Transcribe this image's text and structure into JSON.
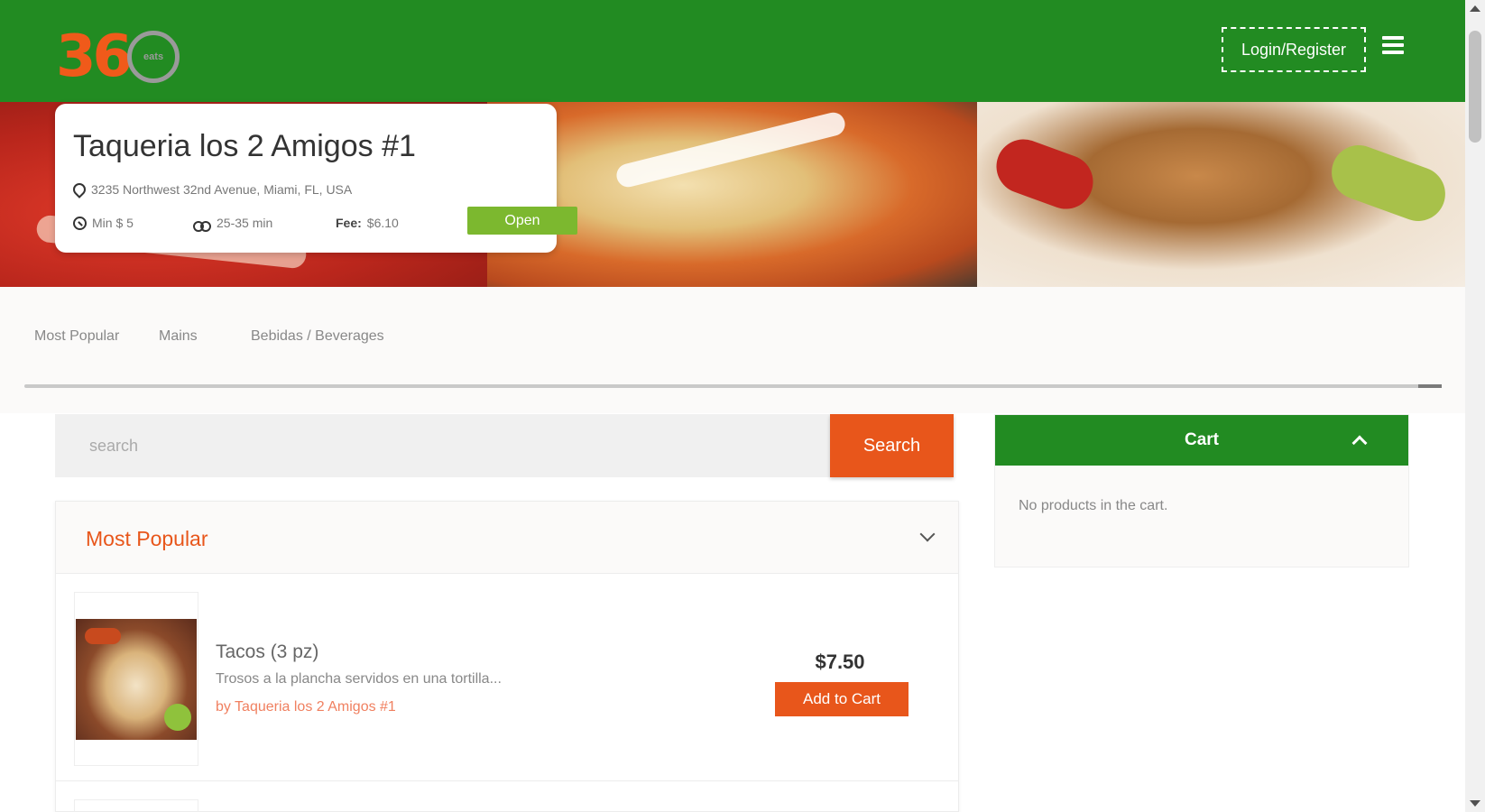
{
  "header": {
    "logo_text": "36",
    "logo_sub": "eats",
    "login_label": "Login/Register"
  },
  "restaurant": {
    "name": "Taqueria los 2 Amigos #1",
    "address": "3235 Northwest 32nd Avenue, Miami, FL, USA",
    "min_order": "Min $ 5",
    "delivery_time": "25-35 min",
    "fee_label": "Fee:",
    "fee_value": "$6.10",
    "status": "Open"
  },
  "categories": [
    "Most Popular",
    "Mains",
    "Bebidas / Beverages"
  ],
  "search": {
    "placeholder": "search",
    "button_label": "Search"
  },
  "menu_section": {
    "title": "Most Popular",
    "products": [
      {
        "name": "Tacos (3 pz)",
        "description": "Trosos a la plancha servidos en una tortilla...",
        "by": "by Taqueria los 2 Amigos #1",
        "price": "$7.50",
        "button_label": "Add to Cart"
      }
    ]
  },
  "cart": {
    "title": "Cart",
    "empty_text": "No products in the cart."
  },
  "colors": {
    "header_green": "#228b22",
    "accent_orange": "#e8561b",
    "open_badge": "#7cb82f"
  },
  "icons": [
    "hamburger-menu-icon",
    "map-pin-icon",
    "min-order-icon",
    "delivery-bike-icon",
    "chevron-down-icon",
    "chevron-up-icon"
  ]
}
